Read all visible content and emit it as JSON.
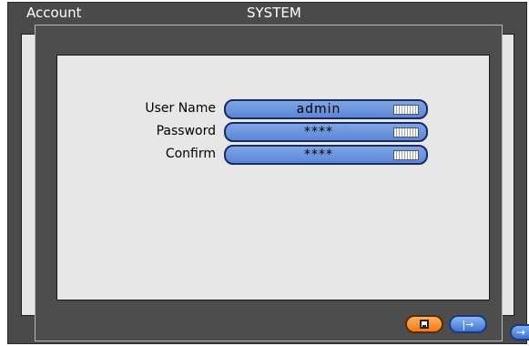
{
  "background": {
    "title_left": "Account",
    "title_center": "SYSTEM",
    "next_icon": "→"
  },
  "form": {
    "user_name_label": "User Name",
    "user_name_value": "admin",
    "password_label": "Password",
    "password_value": "****",
    "confirm_label": "Confirm",
    "confirm_value": "****"
  },
  "buttons": {
    "exit_icon": "|→"
  },
  "icons": {
    "keyboard": "keyboard-icon",
    "save": "save-icon",
    "exit": "exit-icon",
    "next": "next-arrow-icon"
  },
  "colors": {
    "field_blue": "#6f99e0",
    "save_orange": "#f47a12",
    "button_blue": "#3f73d2",
    "window_dark": "#4d4d4d",
    "panel_light": "#e7e7e7"
  }
}
